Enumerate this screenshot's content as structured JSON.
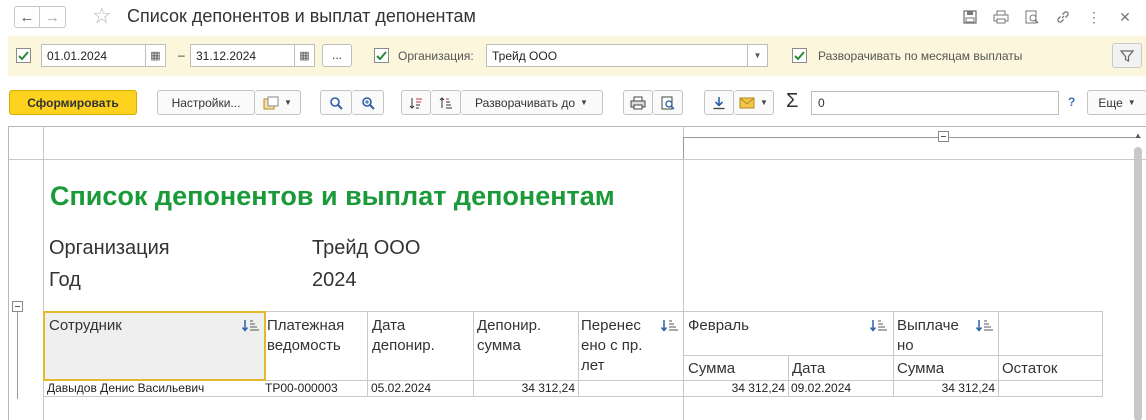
{
  "window": {
    "title": "Список депонентов и выплат депонентам"
  },
  "params": {
    "date_from": "01.01.2024",
    "date_to": "31.12.2024",
    "separator": "–",
    "dots_label": "...",
    "org_label": "Организация:",
    "org_value": "Трейд ООО",
    "expand_label": "Разворачивать по  месяцам выплаты",
    "period_checked": true,
    "org_checked": true,
    "expand_checked": true
  },
  "toolbar": {
    "generate_label": "Сформировать",
    "settings_label": "Настройки...",
    "expand_to_label": "Разворачивать до",
    "sum_value": "0",
    "help_label": "?",
    "more_label": "Еще"
  },
  "report": {
    "title": "Список депонентов и выплат депонентам",
    "org_key": "Организация",
    "org_value": "Трейд ООО",
    "year_key": "Год",
    "year_value": "2024",
    "headers": {
      "employee": "Сотрудник",
      "payroll": [
        "Платежная",
        "ведомость"
      ],
      "deposit_date": [
        "Дата",
        "депонир."
      ],
      "deposit_sum": [
        "Депонир.",
        "сумма"
      ],
      "transferred": [
        "Перенес",
        "ено с пр.",
        "лет"
      ],
      "february": "Февраль",
      "paid": [
        "Выплаче",
        "но"
      ],
      "feb_sum": "Сумма",
      "feb_date": "Дата",
      "paid_sum": "Сумма",
      "remainder": "Остаток"
    },
    "rows": [
      {
        "employee": "Давыдов Денис Васильевич",
        "payroll": "ТР00-000003",
        "deposit_date": "05.02.2024",
        "deposit_sum": "34 312,24",
        "transferred": "",
        "feb_sum": "34 312,24",
        "feb_date": "09.02.2024",
        "paid_sum": "34 312,24",
        "remainder": ""
      }
    ]
  },
  "colors": {
    "accent_yellow": "#fcd21e",
    "params_bg": "#fbf6dc",
    "report_title_green": "#1b9a3a",
    "check_green": "#2a8a3a",
    "link_blue": "#3b71b5"
  }
}
